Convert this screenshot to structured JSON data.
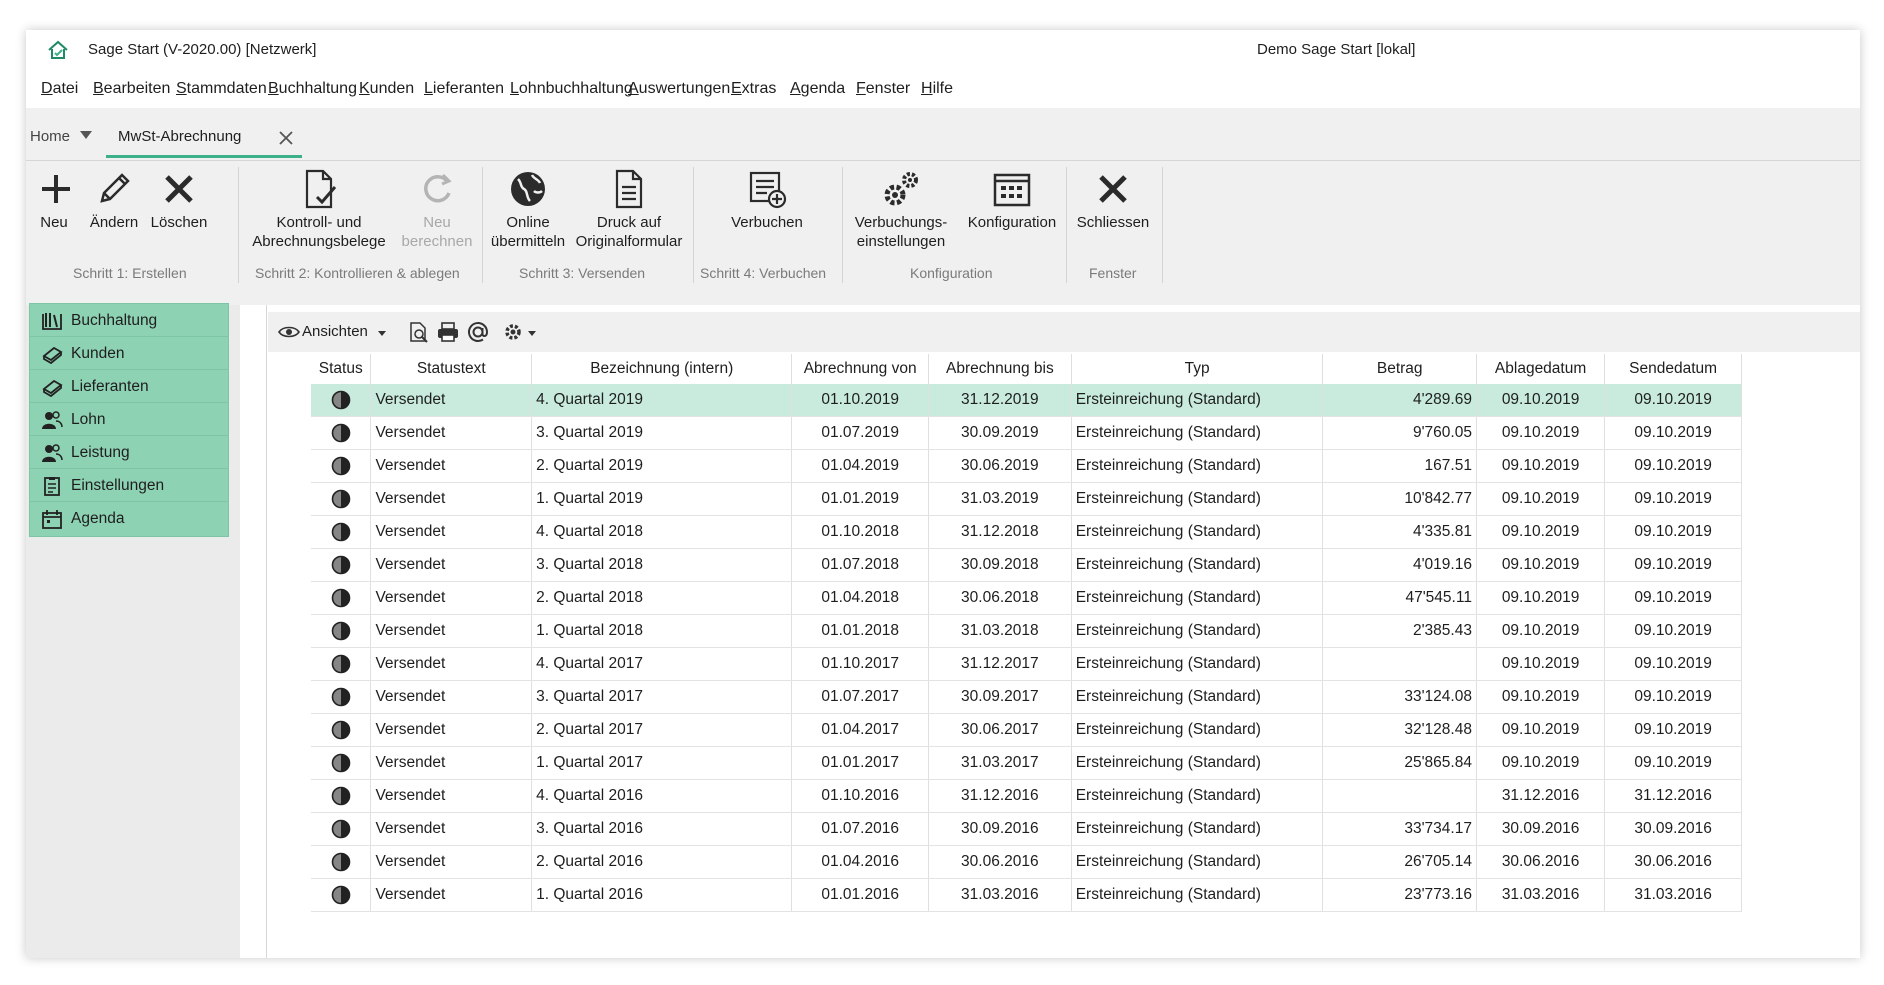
{
  "window": {
    "title_left": "Sage Start (V-2020.00) [Netzwerk]",
    "title_center": "Demo Sage Start [lokal]"
  },
  "menu": [
    {
      "acc": "D",
      "rest": "atei",
      "label": "Datei"
    },
    {
      "acc": "B",
      "rest": "earbeiten",
      "label": "Bearbeiten"
    },
    {
      "acc": "S",
      "rest": "tammdaten",
      "label": "Stammdaten"
    },
    {
      "acc": "B",
      "rest": "uchhaltung",
      "label": "Buchhaltung"
    },
    {
      "acc": "K",
      "rest": "unden",
      "label": "Kunden"
    },
    {
      "acc": "L",
      "rest": "ieferanten",
      "label": "Lieferanten"
    },
    {
      "acc": "L",
      "rest": "ohnbuchhaltung",
      "label": "Lohnbuchhaltung"
    },
    {
      "acc": "A",
      "rest": "uswertungen",
      "label": "Auswertungen"
    },
    {
      "acc": "E",
      "rest": "xtras",
      "label": "Extras"
    },
    {
      "acc": "A",
      "rest": "genda",
      "label": "Agenda"
    },
    {
      "acc": "F",
      "rest": "enster",
      "label": "Fenster"
    },
    {
      "acc": "H",
      "rest": "ilfe",
      "label": "Hilfe"
    }
  ],
  "tabs": {
    "home": "Home",
    "active": "MwSt-Abrechnung"
  },
  "ribbon": {
    "buttons": {
      "neu": "Neu",
      "aendern": "Ändern",
      "loeschen": "Löschen",
      "kontroll_1": "Kontroll- und",
      "kontroll_2": "Abrechnungsbelege",
      "neuber_1": "Neu",
      "neuber_2": "berechnen",
      "online_1": "Online",
      "online_2": "übermitteln",
      "druck_1": "Druck auf",
      "druck_2": "Originalformular",
      "verbuchen": "Verbuchen",
      "verbeinst_1": "Verbuchungs-",
      "verbeinst_2": "einstellungen",
      "konfiguration": "Konfiguration",
      "schliessen": "Schliessen"
    },
    "groups": {
      "g1": "Schritt 1: Erstellen",
      "g2": "Schritt 2: Kontrollieren & ablegen",
      "g3": "Schritt 3: Versenden",
      "g4": "Schritt 4: Verbuchen",
      "g5": "Konfiguration",
      "g6": "Fenster"
    }
  },
  "sidebar": {
    "items": [
      {
        "label": "Buchhaltung",
        "icon": "books-icon"
      },
      {
        "label": "Kunden",
        "icon": "customers-icon"
      },
      {
        "label": "Lieferanten",
        "icon": "suppliers-icon"
      },
      {
        "label": "Lohn",
        "icon": "people-icon"
      },
      {
        "label": "Leistung",
        "icon": "people-icon"
      },
      {
        "label": "Einstellungen",
        "icon": "settings-list-icon"
      },
      {
        "label": "Agenda",
        "icon": "calendar-icon"
      }
    ]
  },
  "toolbar": {
    "ansichten": "Ansichten"
  },
  "grid": {
    "columns": [
      "Status",
      "Statustext",
      "Bezeichnung (intern)",
      "Abrechnung von",
      "Abrechnung bis",
      "Typ",
      "Betrag",
      "Ablagedatum",
      "Sendedatum"
    ],
    "rows": [
      [
        "Versendet",
        "4. Quartal 2019",
        "01.10.2019",
        "31.12.2019",
        "Ersteinreichung (Standard)",
        "4'289.69",
        "09.10.2019",
        "09.10.2019"
      ],
      [
        "Versendet",
        "3. Quartal 2019",
        "01.07.2019",
        "30.09.2019",
        "Ersteinreichung (Standard)",
        "9'760.05",
        "09.10.2019",
        "09.10.2019"
      ],
      [
        "Versendet",
        "2. Quartal 2019",
        "01.04.2019",
        "30.06.2019",
        "Ersteinreichung (Standard)",
        "167.51",
        "09.10.2019",
        "09.10.2019"
      ],
      [
        "Versendet",
        "1. Quartal 2019",
        "01.01.2019",
        "31.03.2019",
        "Ersteinreichung (Standard)",
        "10'842.77",
        "09.10.2019",
        "09.10.2019"
      ],
      [
        "Versendet",
        "4. Quartal 2018",
        "01.10.2018",
        "31.12.2018",
        "Ersteinreichung (Standard)",
        "4'335.81",
        "09.10.2019",
        "09.10.2019"
      ],
      [
        "Versendet",
        "3. Quartal 2018",
        "01.07.2018",
        "30.09.2018",
        "Ersteinreichung (Standard)",
        "4'019.16",
        "09.10.2019",
        "09.10.2019"
      ],
      [
        "Versendet",
        "2. Quartal 2018",
        "01.04.2018",
        "30.06.2018",
        "Ersteinreichung (Standard)",
        "47'545.11",
        "09.10.2019",
        "09.10.2019"
      ],
      [
        "Versendet",
        "1. Quartal 2018",
        "01.01.2018",
        "31.03.2018",
        "Ersteinreichung (Standard)",
        "2'385.43",
        "09.10.2019",
        "09.10.2019"
      ],
      [
        "Versendet",
        "4. Quartal 2017",
        "01.10.2017",
        "31.12.2017",
        "Ersteinreichung (Standard)",
        "",
        "09.10.2019",
        "09.10.2019"
      ],
      [
        "Versendet",
        "3. Quartal 2017",
        "01.07.2017",
        "30.09.2017",
        "Ersteinreichung (Standard)",
        "33'124.08",
        "09.10.2019",
        "09.10.2019"
      ],
      [
        "Versendet",
        "2. Quartal 2017",
        "01.04.2017",
        "30.06.2017",
        "Ersteinreichung (Standard)",
        "32'128.48",
        "09.10.2019",
        "09.10.2019"
      ],
      [
        "Versendet",
        "1. Quartal 2017",
        "01.01.2017",
        "31.03.2017",
        "Ersteinreichung (Standard)",
        "25'865.84",
        "09.10.2019",
        "09.10.2019"
      ],
      [
        "Versendet",
        "4. Quartal 2016",
        "01.10.2016",
        "31.12.2016",
        "Ersteinreichung (Standard)",
        "",
        "31.12.2016",
        "31.12.2016"
      ],
      [
        "Versendet",
        "3. Quartal 2016",
        "01.07.2016",
        "30.09.2016",
        "Ersteinreichung (Standard)",
        "33'734.17",
        "30.09.2016",
        "30.09.2016"
      ],
      [
        "Versendet",
        "2. Quartal 2016",
        "01.04.2016",
        "30.06.2016",
        "Ersteinreichung (Standard)",
        "26'705.14",
        "30.06.2016",
        "30.06.2016"
      ],
      [
        "Versendet",
        "1. Quartal 2016",
        "01.01.2016",
        "31.03.2016",
        "Ersteinreichung (Standard)",
        "23'773.16",
        "31.03.2016",
        "31.03.2016"
      ]
    ],
    "selected_row": 0
  },
  "colors": {
    "accent": "#3cb089",
    "sidebar_item": "#8ed2b4",
    "selected_row": "#c8ebdd"
  }
}
